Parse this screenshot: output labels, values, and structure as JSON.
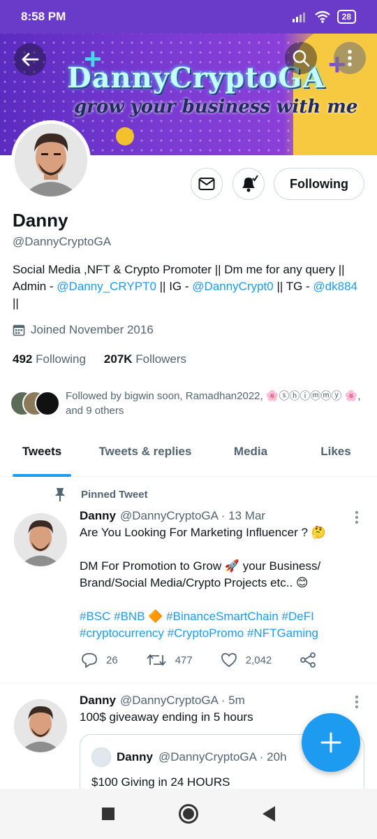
{
  "status_bar": {
    "time": "8:58 PM",
    "battery": "28"
  },
  "banner": {
    "title": "DannyCryptoGA",
    "subtitle": "grow your business with me"
  },
  "header": {
    "follow_button": "Following"
  },
  "profile": {
    "name": "Danny",
    "handle": "@DannyCryptoGA",
    "bio_text_1": "Social Media ,NFT & Crypto Promoter || Dm me for any query || Admin - ",
    "bio_link_1": "@Danny_CRYPT0",
    "bio_text_2": " || IG - ",
    "bio_link_2": "@DannyCrypt0",
    "bio_text_3": " || TG - ",
    "bio_link_3": "@dk884",
    "bio_text_4": " ||",
    "joined": "Joined November 2016",
    "following_count": "492",
    "following_label": "Following",
    "followers_count": "207K",
    "followers_label": "Followers",
    "followed_by": "Followed by bigwin soon, Ramadhan2022, 🌸ⓢⓗⓘⓜⓜⓨ 🌸, and 9 others"
  },
  "tabs": [
    {
      "label": "Tweets"
    },
    {
      "label": "Tweets & replies"
    },
    {
      "label": "Media"
    },
    {
      "label": "Likes"
    }
  ],
  "pinned_label": "Pinned Tweet",
  "tweets": [
    {
      "name": "Danny",
      "meta": "@DannyCryptoGA · 13 Mar",
      "line1": "Are You Looking For Marketing Influencer ? 🤔",
      "line2": "DM For Promotion to Grow 🚀 your Business/ Brand/Social Media/Crypto Projects etc.. 😊",
      "hashtags_1": "#BSC #BNB 🔶 #BinanceSmartChain #DeFI",
      "hashtags_2": "#cryptocurrency #CryptoPromo #NFTGaming",
      "replies": "26",
      "retweets": "477",
      "likes": "2,042"
    },
    {
      "name": "Danny",
      "meta": "@DannyCryptoGA · 5m",
      "text": "100$ giveaway ending in 5 hours",
      "quote_name": "Danny",
      "quote_meta": "@DannyCryptoGA · 20h",
      "quote_text": "$100 Giving in 24 HOURS"
    }
  ],
  "fab_label": "+",
  "colors": {
    "accent": "#1d9bf0",
    "status_bar": "#6a3bc8",
    "banner_yellow": "#f7c940"
  }
}
